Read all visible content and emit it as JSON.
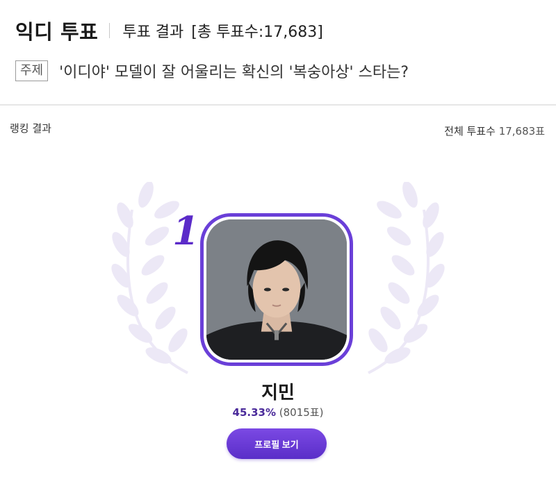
{
  "header": {
    "brand": "익디 투표",
    "result_title": "투표 결과",
    "total_label": "[총 투표수:17,683]"
  },
  "topic": {
    "tag": "주제",
    "text": "'이디야' 모델이 잘 어울리는 확신의 '복숭아상' 스타는?"
  },
  "ranking": {
    "label": "랭킹 결과",
    "total_votes_label": "전체 투표수",
    "total_votes_value": "17,683표"
  },
  "winner": {
    "rank": "1",
    "name": "지민",
    "percent": "45.33%",
    "votes": "(8015표)",
    "vote_fraction": 0.4533,
    "profile_button": "프로필 보기",
    "photo_icon": "person-photo"
  },
  "colors": {
    "accent": "#5b2bc9",
    "button": "#6a3fd8",
    "wreath": "#ece8f6"
  }
}
